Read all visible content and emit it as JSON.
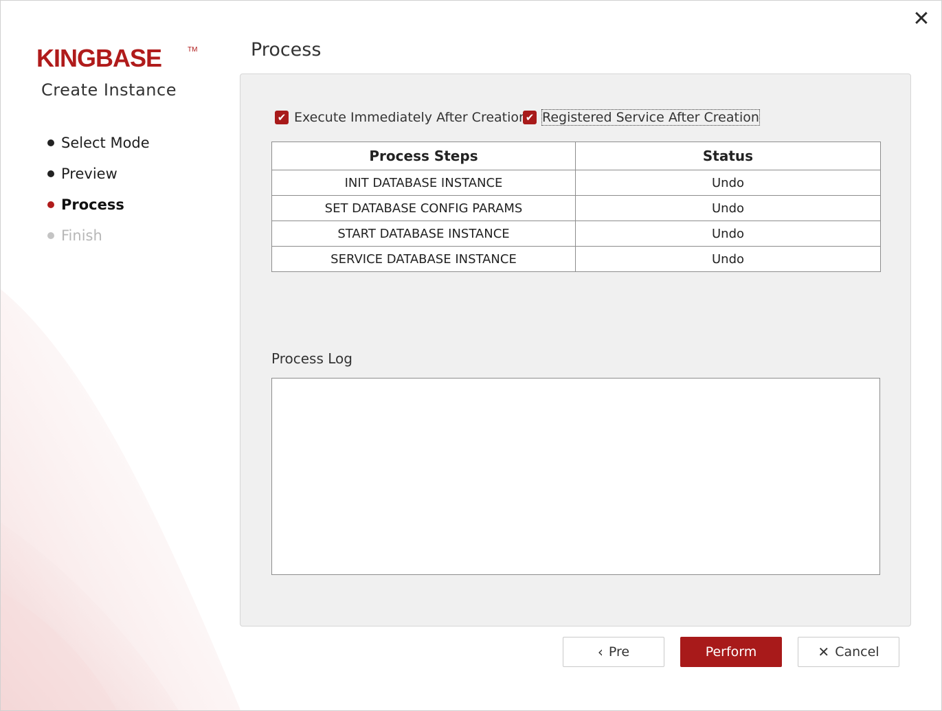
{
  "window": {
    "close_icon": "close-icon"
  },
  "sidebar": {
    "logo_text": "KINGBASE",
    "logo_tm": "TM",
    "title": "Create Instance",
    "steps": [
      {
        "label": "Select Mode",
        "state": "done"
      },
      {
        "label": "Preview",
        "state": "done"
      },
      {
        "label": "Process",
        "state": "active"
      },
      {
        "label": "Finish",
        "state": "disabled"
      }
    ]
  },
  "main": {
    "title": "Process",
    "options": {
      "execute_immediately": {
        "label": "Execute Immediately After Creation",
        "checked": true
      },
      "registered_service": {
        "label": "Registered Service After Creation",
        "checked": true
      }
    },
    "table": {
      "headers": [
        "Process Steps",
        "Status"
      ],
      "rows": [
        [
          "INIT DATABASE INSTANCE",
          "Undo"
        ],
        [
          "SET DATABASE CONFIG PARAMS",
          "Undo"
        ],
        [
          "START DATABASE INSTANCE",
          "Undo"
        ],
        [
          "SERVICE DATABASE INSTANCE",
          "Undo"
        ]
      ]
    },
    "log_label": "Process Log",
    "log_content": ""
  },
  "footer": {
    "pre_label": "Pre",
    "perform_label": "Perform",
    "cancel_label": "Cancel"
  },
  "colors": {
    "accent": "#a81a1a",
    "panel_bg": "#f0f0f0"
  }
}
